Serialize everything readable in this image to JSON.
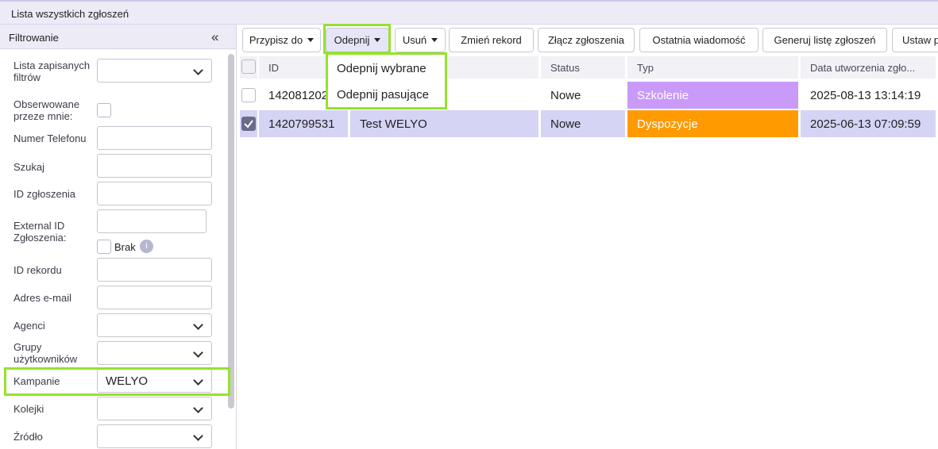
{
  "window": {
    "title": "Lista wszystkich zgłoszeń"
  },
  "sidebar": {
    "header": "Filtrowanie",
    "collapse_glyph": "«",
    "filters": {
      "saved_lists": {
        "label": "Lista zapisanych filtrów",
        "value": ""
      },
      "watched": {
        "label": "Obserwowane przeze mnie:",
        "checked": false
      },
      "phone": {
        "label": "Numer Telefonu",
        "value": ""
      },
      "search": {
        "label": "Szukaj",
        "value": ""
      },
      "ticket_id": {
        "label": "ID zgłoszenia",
        "value": ""
      },
      "external_id": {
        "label": "External ID Zgłoszenia:",
        "value": "",
        "missing_label": "Brak",
        "info": "i"
      },
      "record_id": {
        "label": "ID rekordu",
        "value": ""
      },
      "email": {
        "label": "Adres e-mail",
        "value": ""
      },
      "agents": {
        "label": "Agenci",
        "value": ""
      },
      "user_groups": {
        "label": "Grupy użytkowników",
        "value": ""
      },
      "campaigns": {
        "label": "Kampanie",
        "value": "WELYO"
      },
      "queues": {
        "label": "Kolejki",
        "value": ""
      },
      "source": {
        "label": "Źródło",
        "value": ""
      }
    }
  },
  "toolbar": {
    "assign": "Przypisz do",
    "unpin": "Odepnij",
    "delete": "Usuń",
    "change_record": "Zmień rekord",
    "merge": "Złącz zgłoszenia",
    "last_message": "Ostatnia wiadomość",
    "generate_list": "Generuj listę zgłoszeń",
    "set": "Ustaw p"
  },
  "unpin_menu": {
    "items": [
      "Odepnij wybrane",
      "Odepnij pasujące"
    ]
  },
  "table": {
    "columns": [
      "ID",
      "",
      "Status",
      "Typ",
      "Data utworzenia zgło..."
    ],
    "rows": [
      {
        "id": "142081202",
        "title": "",
        "status": "Nowe",
        "type": "Szkolenie",
        "created": "2025-08-13 13:14:19",
        "checked": false
      },
      {
        "id": "1420799531",
        "title": "Test WELYO",
        "status": "Nowe",
        "type": "Dyspozycje",
        "created": "2025-06-13 07:09:59",
        "checked": true
      }
    ]
  },
  "colors": {
    "highlight": "#95e22c",
    "type_szkolenie": "#c99af8",
    "type_dyspozycje": "#ff9a00",
    "selected_row": "#d5d4f5",
    "header_bg": "#ecebf6"
  }
}
